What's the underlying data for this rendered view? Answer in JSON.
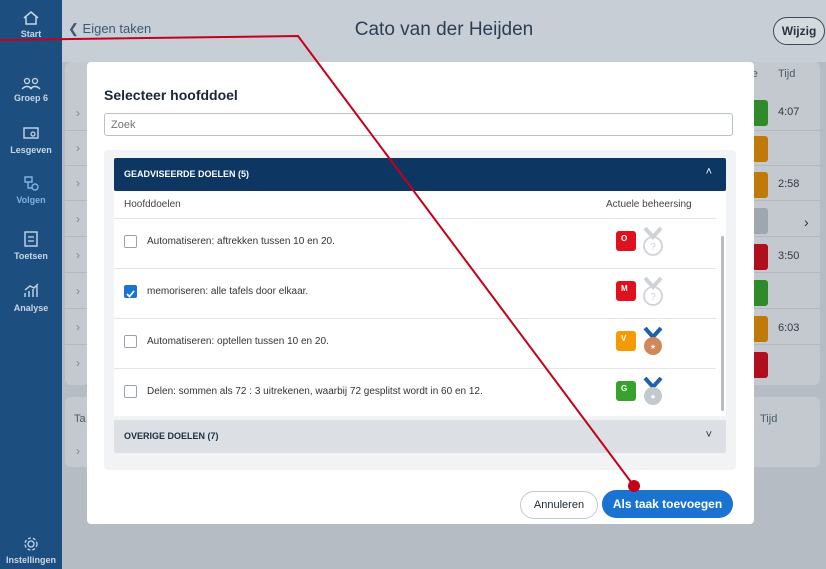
{
  "sidebar": {
    "items": [
      {
        "label": "Start",
        "icon": "home-icon"
      },
      {
        "label": "Groep 6",
        "icon": "group-icon"
      },
      {
        "label": "Lesgeven",
        "icon": "teach-icon"
      },
      {
        "label": "Volgen",
        "icon": "follow-icon"
      },
      {
        "label": "Toetsen",
        "icon": "test-icon"
      },
      {
        "label": "Analyse",
        "icon": "chart-icon"
      },
      {
        "label": "Instellingen",
        "icon": "gear-icon"
      }
    ]
  },
  "header": {
    "back_label": "Eigen taken",
    "title": "Cato van der Heijden",
    "edit_label": "Wijzig"
  },
  "background": {
    "col_score": "ore",
    "col_time": "Tijd",
    "col_ta": "Ta",
    "col_time2": "Tijd",
    "times": [
      "4:07",
      "",
      "2:58",
      "",
      "3:50",
      "",
      "6:03",
      ""
    ]
  },
  "modal": {
    "title": "Selecteer hoofddoel",
    "search_placeholder": "Zoek",
    "section_advised": "GEADVISEERDE DOELEN (5)",
    "col_goals": "Hoofddoelen",
    "col_mastery": "Actuele beheersing",
    "goals": [
      {
        "text": "Automatiseren: aftrekken tussen 10 en 20.",
        "checked": false,
        "level": "O",
        "level_color": "#e0111f",
        "medal": "unknown"
      },
      {
        "text": "memoriseren: alle tafels door elkaar.",
        "checked": true,
        "level": "M",
        "level_color": "#e0111f",
        "medal": "unknown"
      },
      {
        "text": "Automatiseren: optellen tussen 10 en 20.",
        "checked": false,
        "level": "V",
        "level_color": "#f59a00",
        "medal": "bronze"
      },
      {
        "text": "Delen: sommen als 72 : 3 uitrekenen, waarbij 72 gesplitst wordt in 60 en 12.",
        "checked": false,
        "level": "G",
        "level_color": "#35a32c",
        "medal": "silver"
      }
    ],
    "section_other": "OVERIGE DOELEN (7)",
    "cancel_label": "Annuleren",
    "add_label": "Als taak toevoegen"
  },
  "colors": {
    "sidebar": "#1c4f80",
    "header_bar": "#0e3663",
    "primary_button": "#1a73d0",
    "annotation_line": "#c4001a"
  }
}
